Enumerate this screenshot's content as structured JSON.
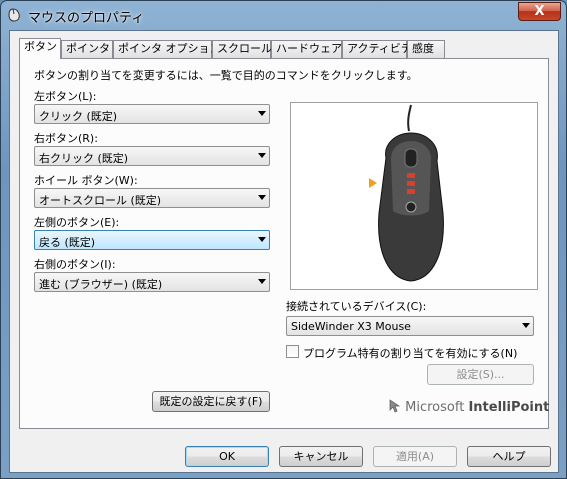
{
  "window": {
    "title": "マウスのプロパティ",
    "close_glyph": "X"
  },
  "tabs": [
    {
      "label": "ボタン",
      "active": true
    },
    {
      "label": "ポインタ"
    },
    {
      "label": "ポインタ オプション"
    },
    {
      "label": "スクロール"
    },
    {
      "label": "ハードウェア"
    },
    {
      "label": "アクティビティ"
    },
    {
      "label": "感度"
    }
  ],
  "panel": {
    "instruction": "ボタンの割り当てを変更するには、一覧で目的のコマンドをクリックします。",
    "assignments": [
      {
        "label": "左ボタン(L):",
        "value": "クリック (既定)"
      },
      {
        "label": "右ボタン(R):",
        "value": "右クリック (既定)"
      },
      {
        "label": "ホイール ボタン(W):",
        "value": "オートスクロール (既定)"
      },
      {
        "label": "左側のボタン(E):",
        "value": "戻る (既定)",
        "focused": true
      },
      {
        "label": "右側のボタン(I):",
        "value": "進む (ブラウザー) (既定)"
      }
    ],
    "device_label": "接続されているデバイス(C):",
    "device_value": "SideWinder X3 Mouse",
    "program_specific_label": "プログラム特有の割り当てを有効にする(N)",
    "program_specific_checked": false,
    "settings_button": "設定(S)...",
    "restore_defaults_button": "既定の設定に戻す(F)",
    "brand_prefix": "Microsoft",
    "brand_name": "IntelliPoint"
  },
  "footer": {
    "ok": "OK",
    "cancel": "キャンセル",
    "apply": "適用(A)",
    "help": "ヘルプ"
  },
  "colors": {
    "indicator": "#f0a020",
    "mouse_body": "#3a3a3a",
    "mouse_led": "#d8402a"
  }
}
